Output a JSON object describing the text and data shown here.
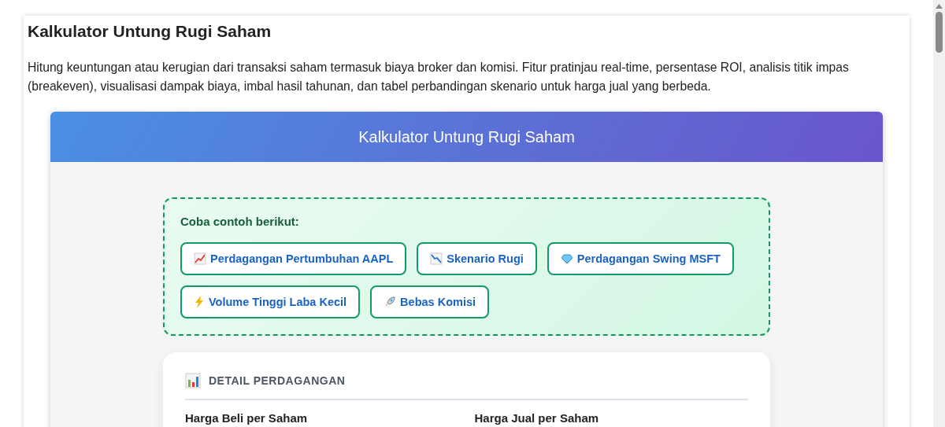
{
  "page": {
    "title": "Kalkulator Untung Rugi Saham",
    "description": "Hitung keuntungan atau kerugian dari transaksi saham termasuk biaya broker dan komisi. Fitur pratinjau real-time, persentase ROI, analisis titik impas (breakeven), visualisasi dampak biaya, imbal hasil tahunan, dan tabel perbandingan skenario untuk harga jual yang berbeda."
  },
  "calculator": {
    "title": "Kalkulator Untung Rugi Saham",
    "examples": {
      "heading": "Coba contoh berikut:",
      "buttons": [
        {
          "kind": "chart-up",
          "label": "Perdagangan Pertumbuhan AAPL"
        },
        {
          "kind": "chart-down",
          "label": "Skenario Rugi"
        },
        {
          "kind": "gem",
          "label": "Perdagangan Swing MSFT"
        },
        {
          "kind": "bolt",
          "label": "Volume Tinggi Laba Kecil"
        },
        {
          "kind": "rocket",
          "label": "Bebas Komisi"
        }
      ]
    },
    "section": {
      "heading": "DETAIL PERDAGANGAN",
      "fields": [
        {
          "label": "Harga Beli per Saham"
        },
        {
          "label": "Harga Jual per Saham"
        }
      ]
    }
  }
}
